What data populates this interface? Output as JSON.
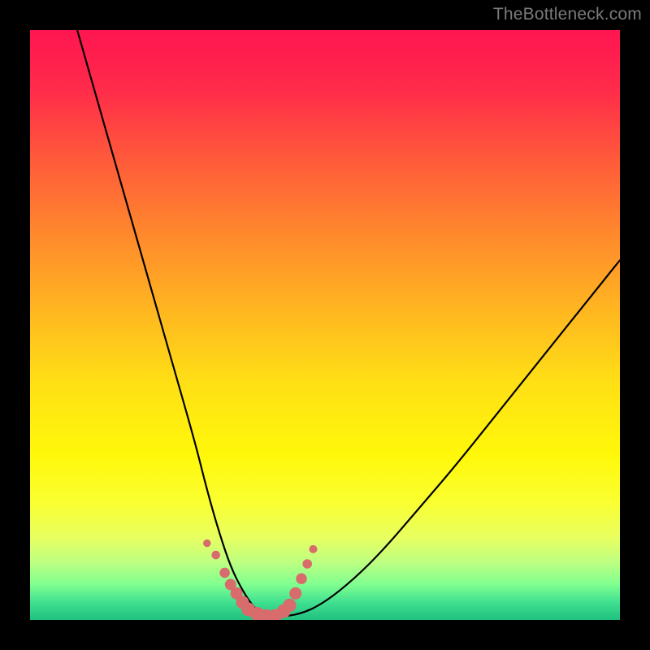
{
  "watermark": "TheBottleneck.com",
  "chart_data": {
    "type": "line",
    "title": "",
    "xlabel": "",
    "ylabel": "",
    "xlim": [
      0,
      100
    ],
    "ylim": [
      0,
      100
    ],
    "series": [
      {
        "name": "bottleneck-curve",
        "x": [
          8,
          12,
          16,
          20,
          24,
          28,
          30,
          32,
          34,
          36,
          38,
          40,
          42,
          46,
          50,
          55,
          60,
          66,
          72,
          80,
          88,
          96,
          100
        ],
        "values": [
          100,
          86,
          72,
          58,
          44,
          30,
          22,
          15,
          9,
          5,
          2,
          0.5,
          0.5,
          1,
          3,
          7,
          12,
          19,
          26,
          36,
          46,
          56,
          61
        ]
      }
    ],
    "markers": {
      "name": "highlight-points",
      "x": [
        30.0,
        31.5,
        33.0,
        34.0,
        35.0,
        36.0,
        37.0,
        38.5,
        40.0,
        41.5,
        43.0,
        44.0,
        45.0,
        46.0,
        47.0,
        48.0
      ],
      "values": [
        13.0,
        11.0,
        8.0,
        6.0,
        4.5,
        3.0,
        1.8,
        1.0,
        0.6,
        0.6,
        1.5,
        2.5,
        4.5,
        7.0,
        9.5,
        12.0
      ],
      "color": "#d86b6b",
      "radius_base": 4,
      "radius_peak": 9
    }
  }
}
